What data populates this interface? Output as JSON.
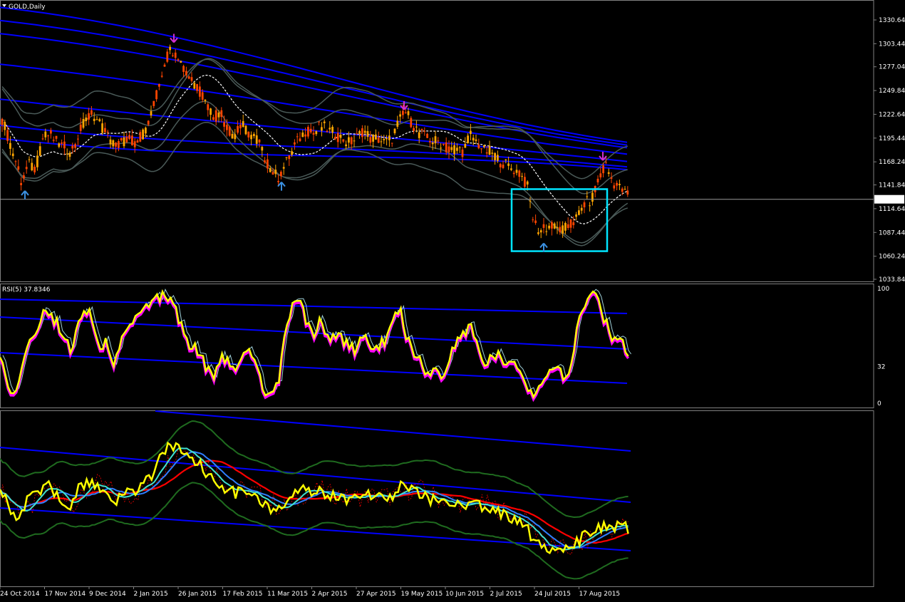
{
  "window": {
    "symbol_label": "GOLD,Daily"
  },
  "colors": {
    "background": "#000000",
    "frame": "#808080",
    "bull_candle": "#ffa500",
    "bear_candle": "#ff4500",
    "blue_band": "#0000ff",
    "envelope_band": "#4a5a58",
    "mid_line": "#ffffff",
    "rsi_line": "#ffff00",
    "rsi_shadow": "#ff00ff",
    "cyan": "#00e5ff",
    "red": "#ff0000",
    "green_band": "#1f6b1f",
    "up_arrow": "#3a8fe0",
    "down_arrow": "#d030d0"
  },
  "chart_data": [
    {
      "type": "candlestick",
      "panel": "main",
      "title": "GOLD,Daily",
      "ylim": [
        1033.84,
        1330.64
      ],
      "y_ticks": [
        "1330.64",
        "1303.44",
        "1277.04",
        "1249.84",
        "1222.64",
        "1195.44",
        "1168.24",
        "1141.84",
        "1114.64",
        "1087.44",
        "1060.24",
        "1033.84"
      ],
      "current_price": "1125.40",
      "x_ticks": [
        "24 Oct 2014",
        "17 Nov 2014",
        "9 Dec 2014",
        "2 Jan 2015",
        "26 Jan 2015",
        "17 Feb 2015",
        "11 Mar 2015",
        "2 Apr 2015",
        "27 Apr 2015",
        "19 May 2015",
        "10 Jun 2015",
        "2 Jul 2015",
        "24 Jul 2015",
        "17 Aug 2015"
      ],
      "close_path": [
        [
          0,
          1225
        ],
        [
          10,
          1200
        ],
        [
          20,
          1175
        ],
        [
          30,
          1145
        ],
        [
          40,
          1165
        ],
        [
          50,
          1160
        ],
        [
          60,
          1195
        ],
        [
          70,
          1200
        ],
        [
          80,
          1190
        ],
        [
          90,
          1185
        ],
        [
          100,
          1180
        ],
        [
          110,
          1200
        ],
        [
          120,
          1215
        ],
        [
          130,
          1225
        ],
        [
          140,
          1210
        ],
        [
          150,
          1200
        ],
        [
          160,
          1185
        ],
        [
          170,
          1190
        ],
        [
          180,
          1195
        ],
        [
          190,
          1190
        ],
        [
          200,
          1200
        ],
        [
          210,
          1215
        ],
        [
          220,
          1245
        ],
        [
          230,
          1280
        ],
        [
          240,
          1298
        ],
        [
          250,
          1290
        ],
        [
          260,
          1270
        ],
        [
          270,
          1262
        ],
        [
          280,
          1250
        ],
        [
          290,
          1235
        ],
        [
          300,
          1220
        ],
        [
          310,
          1222
        ],
        [
          320,
          1205
        ],
        [
          330,
          1200
        ],
        [
          340,
          1210
        ],
        [
          350,
          1200
        ],
        [
          360,
          1195
        ],
        [
          370,
          1175
        ],
        [
          380,
          1160
        ],
        [
          390,
          1150
        ],
        [
          400,
          1165
        ],
        [
          410,
          1180
        ],
        [
          420,
          1195
        ],
        [
          430,
          1205
        ],
        [
          440,
          1200
        ],
        [
          450,
          1210
        ],
        [
          460,
          1205
        ],
        [
          470,
          1200
        ],
        [
          480,
          1195
        ],
        [
          490,
          1190
        ],
        [
          500,
          1195
        ],
        [
          510,
          1205
        ],
        [
          520,
          1195
        ],
        [
          530,
          1195
        ],
        [
          540,
          1190
        ],
        [
          550,
          1195
        ],
        [
          560,
          1215
        ],
        [
          570,
          1225
        ],
        [
          580,
          1210
        ],
        [
          590,
          1200
        ],
        [
          600,
          1195
        ],
        [
          610,
          1192
        ],
        [
          620,
          1190
        ],
        [
          630,
          1180
        ],
        [
          640,
          1185
        ],
        [
          650,
          1180
        ],
        [
          660,
          1200
        ],
        [
          670,
          1190
        ],
        [
          680,
          1180
        ],
        [
          690,
          1180
        ],
        [
          700,
          1170
        ],
        [
          710,
          1165
        ],
        [
          720,
          1160
        ],
        [
          730,
          1155
        ],
        [
          740,
          1140
        ],
        [
          750,
          1095
        ],
        [
          760,
          1090
        ],
        [
          770,
          1095
        ],
        [
          780,
          1092
        ],
        [
          790,
          1090
        ],
        [
          800,
          1095
        ],
        [
          810,
          1105
        ],
        [
          820,
          1120
        ],
        [
          830,
          1125
        ],
        [
          840,
          1145
        ],
        [
          850,
          1165
        ],
        [
          860,
          1145
        ],
        [
          870,
          1138
        ],
        [
          880,
          1130
        ]
      ],
      "annotations": [
        {
          "type": "arrow-up",
          "x_index": 35,
          "price": 1135
        },
        {
          "type": "arrow-down",
          "x_index": 244,
          "price": 1305
        },
        {
          "type": "arrow-up",
          "x_index": 395,
          "price": 1145
        },
        {
          "type": "arrow-down",
          "x_index": 567,
          "price": 1228
        },
        {
          "type": "arrow-down",
          "x_index": 846,
          "price": 1170
        },
        {
          "type": "arrow-up",
          "x_index": 763,
          "price": 1075
        }
      ],
      "highlight_box": {
        "x_from": 718,
        "x_to": 852,
        "price_high": 1137,
        "price_low": 1066
      }
    },
    {
      "type": "line",
      "panel": "rsi",
      "title": "RSI(5) 37.8346",
      "ylim": [
        0,
        100
      ],
      "y_ticks": [
        "100",
        "32",
        "0"
      ],
      "series": [
        {
          "values": [
            [
              0,
              45
            ],
            [
              10,
              15
            ],
            [
              20,
              10
            ],
            [
              30,
              25
            ],
            [
              40,
              55
            ],
            [
              50,
              60
            ],
            [
              60,
              80
            ],
            [
              70,
              75
            ],
            [
              80,
              70
            ],
            [
              90,
              60
            ],
            [
              100,
              45
            ],
            [
              110,
              70
            ],
            [
              120,
              80
            ],
            [
              130,
              75
            ],
            [
              140,
              50
            ],
            [
              150,
              55
            ],
            [
              160,
              35
            ],
            [
              170,
              55
            ],
            [
              180,
              65
            ],
            [
              190,
              75
            ],
            [
              200,
              80
            ],
            [
              210,
              85
            ],
            [
              220,
              90
            ],
            [
              230,
              95
            ],
            [
              240,
              90
            ],
            [
              250,
              75
            ],
            [
              260,
              55
            ],
            [
              270,
              50
            ],
            [
              280,
              45
            ],
            [
              290,
              30
            ],
            [
              300,
              25
            ],
            [
              310,
              40
            ],
            [
              320,
              35
            ],
            [
              330,
              30
            ],
            [
              340,
              45
            ],
            [
              350,
              50
            ],
            [
              360,
              30
            ],
            [
              370,
              10
            ],
            [
              380,
              5
            ],
            [
              390,
              15
            ],
            [
              400,
              60
            ],
            [
              410,
              85
            ],
            [
              420,
              90
            ],
            [
              430,
              70
            ],
            [
              440,
              60
            ],
            [
              450,
              75
            ],
            [
              460,
              55
            ],
            [
              470,
              60
            ],
            [
              480,
              55
            ],
            [
              490,
              50
            ],
            [
              500,
              45
            ],
            [
              510,
              60
            ],
            [
              520,
              45
            ],
            [
              530,
              50
            ],
            [
              540,
              55
            ],
            [
              550,
              65
            ],
            [
              560,
              85
            ],
            [
              570,
              60
            ],
            [
              580,
              45
            ],
            [
              590,
              35
            ],
            [
              600,
              25
            ],
            [
              610,
              30
            ],
            [
              620,
              20
            ],
            [
              630,
              40
            ],
            [
              640,
              55
            ],
            [
              650,
              60
            ],
            [
              660,
              70
            ],
            [
              670,
              50
            ],
            [
              680,
              35
            ],
            [
              690,
              40
            ],
            [
              700,
              45
            ],
            [
              710,
              35
            ],
            [
              720,
              40
            ],
            [
              730,
              25
            ],
            [
              740,
              10
            ],
            [
              750,
              5
            ],
            [
              760,
              20
            ],
            [
              770,
              25
            ],
            [
              780,
              30
            ],
            [
              790,
              25
            ],
            [
              800,
              30
            ],
            [
              810,
              65
            ],
            [
              820,
              85
            ],
            [
              830,
              95
            ],
            [
              840,
              90
            ],
            [
              850,
              70
            ],
            [
              860,
              55
            ],
            [
              870,
              60
            ],
            [
              880,
              38
            ]
          ]
        }
      ]
    },
    {
      "type": "line",
      "panel": "lower",
      "ylim": [
        0,
        100
      ],
      "series": [
        {
          "values": [
            [
              0,
              55
            ],
            [
              10,
              48
            ],
            [
              20,
              40
            ],
            [
              30,
              42
            ],
            [
              40,
              50
            ],
            [
              50,
              52
            ],
            [
              60,
              56
            ],
            [
              70,
              58
            ],
            [
              80,
              52
            ],
            [
              90,
              48
            ],
            [
              100,
              47
            ],
            [
              110,
              55
            ],
            [
              120,
              58
            ],
            [
              130,
              60
            ],
            [
              140,
              55
            ],
            [
              150,
              50
            ],
            [
              160,
              48
            ],
            [
              170,
              52
            ],
            [
              180,
              54
            ],
            [
              190,
              55
            ],
            [
              200,
              58
            ],
            [
              210,
              62
            ],
            [
              220,
              70
            ],
            [
              230,
              78
            ],
            [
              240,
              82
            ],
            [
              250,
              80
            ],
            [
              260,
              75
            ],
            [
              270,
              72
            ],
            [
              280,
              70
            ],
            [
              290,
              65
            ],
            [
              300,
              60
            ],
            [
              310,
              58
            ],
            [
              320,
              55
            ],
            [
              330,
              53
            ],
            [
              340,
              55
            ],
            [
              350,
              52
            ],
            [
              360,
              50
            ],
            [
              370,
              46
            ],
            [
              380,
              43
            ],
            [
              390,
              42
            ],
            [
              400,
              45
            ],
            [
              410,
              50
            ],
            [
              420,
              55
            ],
            [
              430,
              55
            ],
            [
              440,
              53
            ],
            [
              450,
              54
            ],
            [
              460,
              52
            ],
            [
              470,
              52
            ],
            [
              480,
              50
            ],
            [
              490,
              50
            ],
            [
              500,
              51
            ],
            [
              510,
              53
            ],
            [
              520,
              51
            ],
            [
              530,
              50
            ],
            [
              540,
              50
            ],
            [
              550,
              52
            ],
            [
              560,
              57
            ],
            [
              570,
              58
            ],
            [
              580,
              54
            ],
            [
              590,
              52
            ],
            [
              600,
              50
            ],
            [
              610,
              49
            ],
            [
              620,
              48
            ],
            [
              630,
              46
            ],
            [
              640,
              47
            ],
            [
              650,
              46
            ],
            [
              660,
              49
            ],
            [
              670,
              47
            ],
            [
              680,
              45
            ],
            [
              690,
              44
            ],
            [
              700,
              42
            ],
            [
              710,
              40
            ],
            [
              720,
              39
            ],
            [
              730,
              37
            ],
            [
              740,
              33
            ],
            [
              750,
              25
            ],
            [
              760,
              22
            ],
            [
              770,
              22
            ],
            [
              780,
              20
            ],
            [
              790,
              20
            ],
            [
              800,
              22
            ],
            [
              810,
              25
            ],
            [
              820,
              28
            ],
            [
              830,
              30
            ],
            [
              840,
              32
            ],
            [
              850,
              35
            ],
            [
              860,
              34
            ],
            [
              870,
              34
            ],
            [
              880,
              33
            ]
          ]
        }
      ]
    }
  ]
}
